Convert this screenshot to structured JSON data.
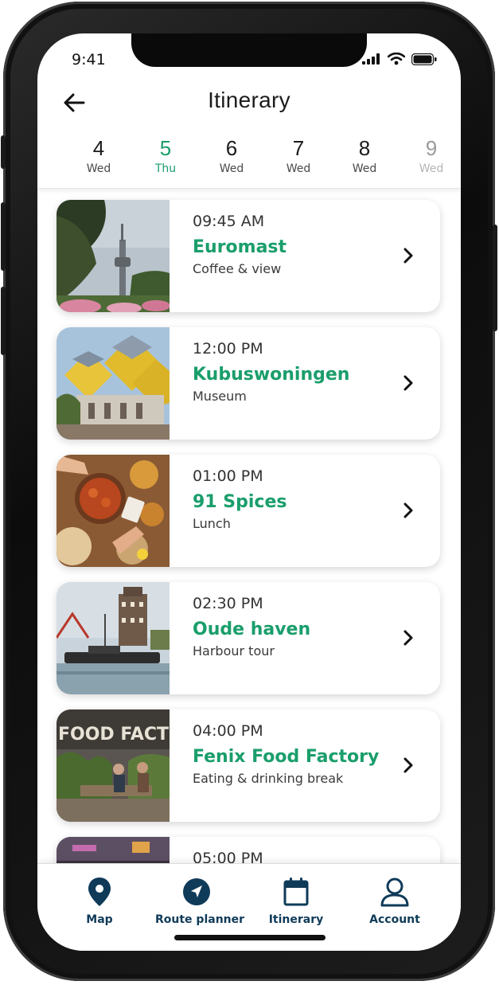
{
  "status_bar": {
    "time": "9:41"
  },
  "header": {
    "title": "Itinerary",
    "back_icon": "arrow-left-icon"
  },
  "days": [
    {
      "num": "4",
      "dow": "Wed",
      "state": "normal"
    },
    {
      "num": "5",
      "dow": "Thu",
      "state": "active"
    },
    {
      "num": "6",
      "dow": "Wed",
      "state": "normal"
    },
    {
      "num": "7",
      "dow": "Wed",
      "state": "normal"
    },
    {
      "num": "8",
      "dow": "Wed",
      "state": "normal"
    },
    {
      "num": "9",
      "dow": "Wed",
      "state": "faded"
    }
  ],
  "items": [
    {
      "time": "09:45 AM",
      "name": "Euromast",
      "sub": "Coffee & view",
      "photo": "tower-trees-photo"
    },
    {
      "time": "12:00 PM",
      "name": "Kubuswoningen",
      "sub": "Museum",
      "photo": "cube-houses-photo"
    },
    {
      "time": "01:00 PM",
      "name": "91 Spices",
      "sub": "Lunch",
      "photo": "food-table-photo"
    },
    {
      "time": "02:30 PM",
      "name": "Oude haven",
      "sub": "Harbour tour",
      "photo": "harbour-photo"
    },
    {
      "time": "04:00 PM",
      "name": "Fenix Food Factory",
      "sub": "Eating & drinking break",
      "photo": "food-factory-photo",
      "sign_text": "FOOD FACTOR"
    },
    {
      "time": "05:00 PM",
      "name": "",
      "sub": "",
      "photo": "night-street-photo"
    }
  ],
  "tabbar": [
    {
      "label": "Map",
      "icon": "map-pin-icon"
    },
    {
      "label": "Route planner",
      "icon": "navigation-icon"
    },
    {
      "label": "Itinerary",
      "icon": "calendar-icon"
    },
    {
      "label": "Account",
      "icon": "user-icon"
    }
  ],
  "colors": {
    "accent": "#1a9e6b",
    "tab": "#0f3b59",
    "text": "#1c1c1c"
  }
}
